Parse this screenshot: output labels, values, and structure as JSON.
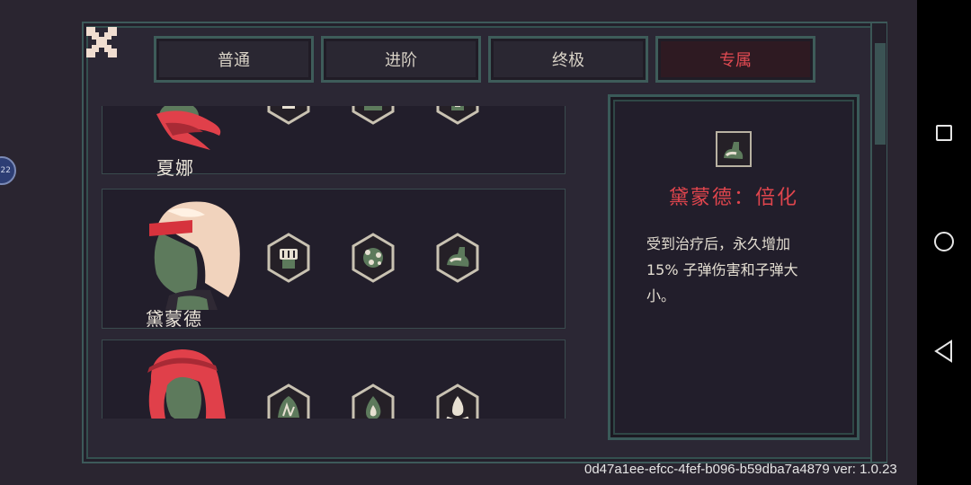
{
  "tabs": [
    {
      "label": "普通",
      "active": false
    },
    {
      "label": "进阶",
      "active": false
    },
    {
      "label": "终极",
      "active": false
    },
    {
      "label": "专属",
      "active": true
    }
  ],
  "characters": [
    {
      "name": "夏娜",
      "hair": "#e0404a",
      "skin": "#5d7a5c",
      "upgrades": [
        "lightning-hex-icon",
        "arrow-hex-icon",
        "cylinder-hex-icon"
      ]
    },
    {
      "name": "黛蒙德",
      "hair": "#f1d3bd",
      "skin": "#5d7a5c",
      "upgrades": [
        "fist-hex-icon",
        "explosion-hex-icon",
        "flex-arm-hex-icon"
      ]
    },
    {
      "name": "",
      "hair": "#e0404a",
      "skin": "#5d7a5c",
      "upgrades": [
        "leaf-hex-icon",
        "flame-hex-icon",
        "water-flame-hex-icon"
      ]
    }
  ],
  "detail": {
    "title": "黛蒙德：倍化",
    "desc_lines": [
      "受到治疗后，永久增加",
      "15% 子弹伤害和子弹大",
      "小。"
    ],
    "icon": "flex-arm-icon"
  },
  "side_button": {
    "label": "22"
  },
  "version_text": "0d47a1ee-efcc-4fef-b096-b59dba7a4879 ver: 1.0.23",
  "colors": {
    "accent": "#e0454d",
    "frame": "#3e5c5a",
    "background": "#2a2530"
  }
}
